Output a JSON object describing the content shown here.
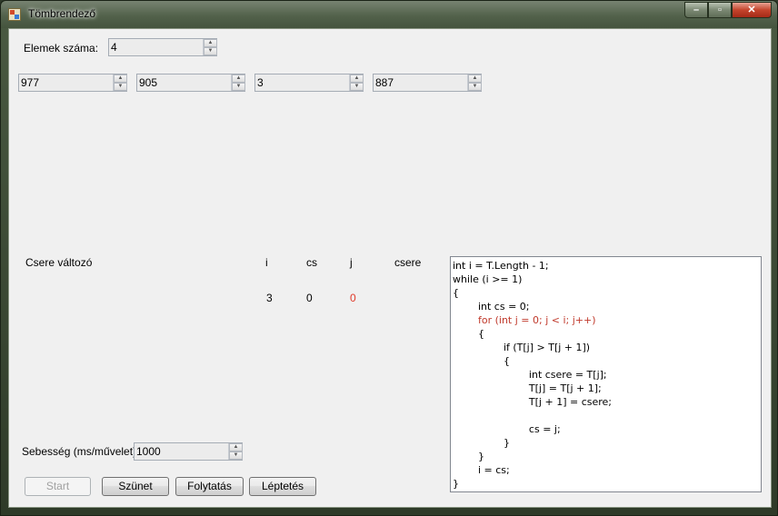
{
  "window": {
    "title": "Tömbrendező"
  },
  "elements_count": {
    "label": "Elemek száma:",
    "value": "4"
  },
  "array_values": [
    "977",
    "905",
    "3",
    "887"
  ],
  "variables": {
    "swap_label": "Csere változó",
    "headers": [
      "i",
      "cs",
      "j",
      "csere"
    ],
    "values": [
      "3",
      "0",
      "0",
      ""
    ],
    "highlight_color": "#e03a2a"
  },
  "speed": {
    "label": "Sebesség (ms/művelet):",
    "value": "1000"
  },
  "buttons": {
    "start": "Start",
    "pause": "Szünet",
    "resume": "Folytatás",
    "step": "Léptetés"
  },
  "code": {
    "highlighted_line": 4,
    "lines": [
      "int i = T.Length - 1;",
      "while (i >= 1)",
      "{",
      "        int cs = 0;",
      "        for (int j = 0; j < i; j++)",
      "        {",
      "                if (T[j] > T[j + 1])",
      "                {",
      "                        int csere = T[j];",
      "                        T[j] = T[j + 1];",
      "                        T[j + 1] = csere;",
      "",
      "                        cs = j;",
      "                }",
      "        }",
      "        i = cs;",
      "}"
    ]
  }
}
